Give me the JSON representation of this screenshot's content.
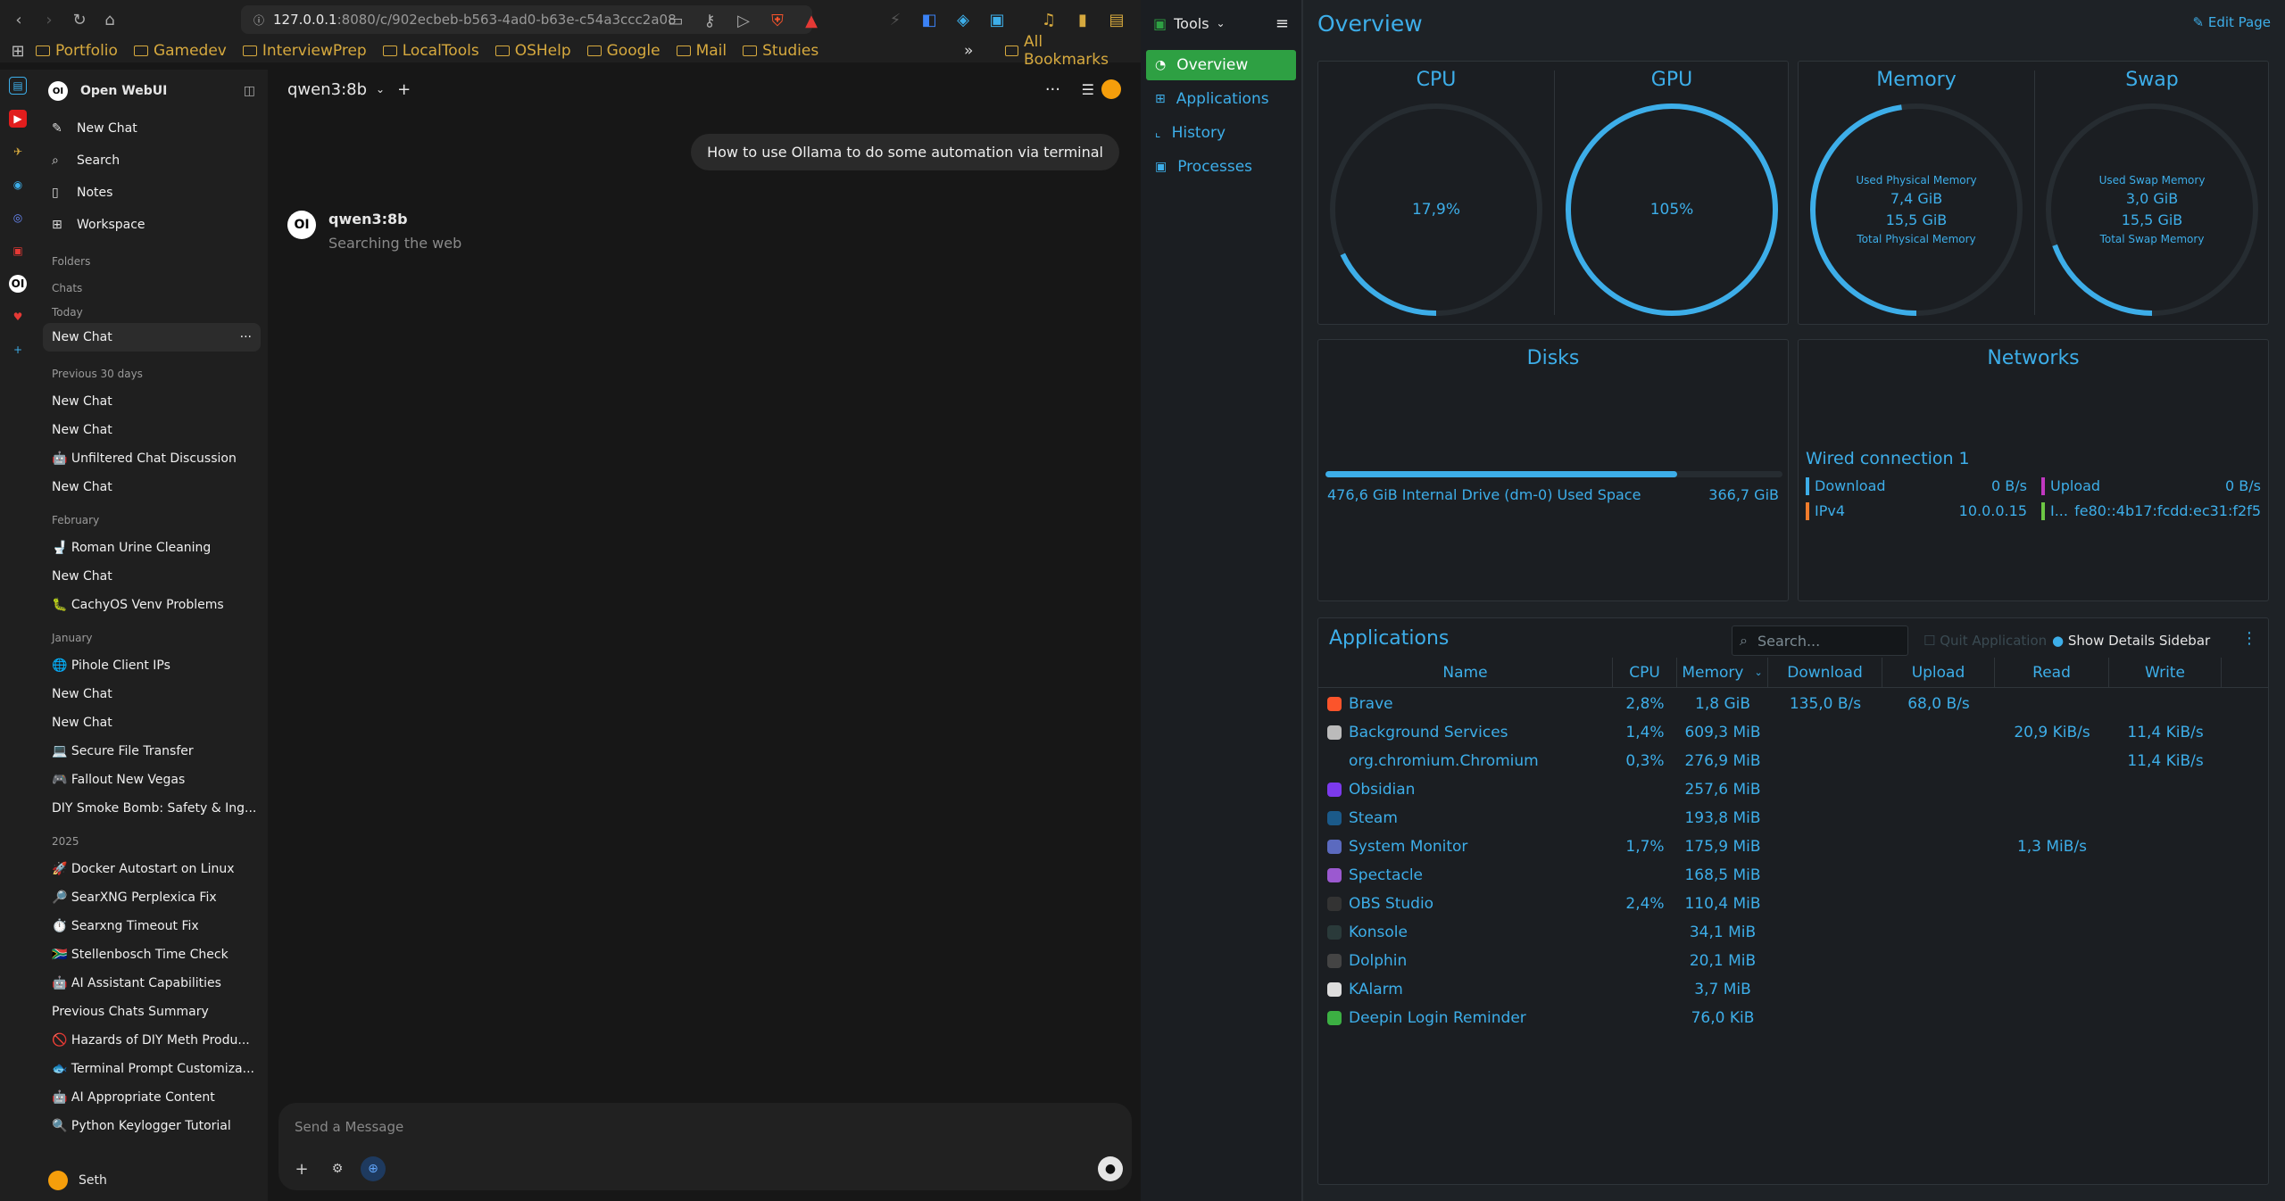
{
  "browser": {
    "url_host": "127.0.0.1",
    "url_path": ":8080/c/902ecbeb-b563-4ad0-b63e-c54a3ccc2a08",
    "bookmarks": [
      "Portfolio",
      "Gamedev",
      "InterviewPrep",
      "LocalTools",
      "OSHelp",
      "Google",
      "Mail",
      "Studies"
    ],
    "overflow": "»",
    "all_bookmarks": "All Bookmarks"
  },
  "owui": {
    "app_name": "Open WebUI",
    "menu": {
      "new_chat": "New Chat",
      "search": "Search",
      "notes": "Notes",
      "workspace": "Workspace"
    },
    "sections": {
      "folders": "Folders",
      "chats": "Chats",
      "today": "Today",
      "prev30": "Previous 30 days",
      "feb": "February",
      "jan": "January",
      "y2025": "2025"
    },
    "today_chats": [
      "New Chat"
    ],
    "prev30_chats": [
      "New Chat",
      "New Chat",
      "🤖 Unfiltered Chat Discussion",
      "New Chat"
    ],
    "feb_chats": [
      "🚽 Roman Urine Cleaning",
      "New Chat",
      "🐛 CachyOS Venv Problems"
    ],
    "jan_chats": [
      "🌐 Pihole Client IPs",
      "New Chat",
      "New Chat",
      "💻 Secure File Transfer",
      "🎮 Fallout New Vegas",
      "DIY Smoke Bomb: Safety & Ing..."
    ],
    "y2025_chats": [
      "🚀 Docker Autostart on Linux",
      "🔎 SearXNG Perplexica Fix",
      "⏱️ Searxng Timeout Fix",
      "🇿🇦 Stellenbosch Time Check",
      "🤖 AI Assistant Capabilities",
      "Previous Chats Summary",
      "🚫 Hazards of DIY Meth Produ...",
      "🐟 Terminal Prompt Customiza...",
      "🤖 AI Appropriate Content",
      "🔍 Python Keylogger Tutorial"
    ],
    "user": "Seth",
    "model": "qwen3:8b",
    "user_message": "How to use Ollama to do some automation via terminal",
    "assistant_name": "qwen3:8b",
    "assistant_status": "Searching the web",
    "composer_placeholder": "Send a Message"
  },
  "sysmon": {
    "tools": "Tools",
    "nav": [
      "Overview",
      "Applications",
      "History",
      "Processes"
    ],
    "title": "Overview",
    "edit_page": "Edit Page",
    "cpu": {
      "title": "CPU",
      "value": "17,9%",
      "fraction": 0.179
    },
    "gpu": {
      "title": "GPU",
      "value": "105%",
      "fraction": 1.0
    },
    "memory": {
      "title": "Memory",
      "used_label": "Used Physical Memory",
      "used": "7,4 GiB",
      "total": "15,5 GiB",
      "total_label": "Total Physical Memory",
      "fraction": 0.477
    },
    "swap": {
      "title": "Swap",
      "used_label": "Used Swap Memory",
      "used": "3,0 GiB",
      "total": "15,5 GiB",
      "total_label": "Total Swap Memory",
      "fraction": 0.194
    },
    "disks": {
      "title": "Disks",
      "label": "476,6 GiB Internal Drive (dm-0) Used Space",
      "value": "366,7 GiB",
      "fraction": 0.77
    },
    "networks": {
      "title": "Networks",
      "conn": "Wired connection 1",
      "download_label": "Download",
      "download": "0 B/s",
      "upload_label": "Upload",
      "upload": "0 B/s",
      "ipv4_label": "IPv4",
      "ipv4": "10.0.0.15",
      "ipv6_label": "I...",
      "ipv6": "fe80::4b17:fcdd:ec31:f2f5"
    },
    "apps": {
      "title": "Applications",
      "search_placeholder": "Search...",
      "quit": "Quit Application",
      "details": "Show Details Sidebar",
      "columns": [
        "Name",
        "CPU",
        "Memory",
        "Download",
        "Upload",
        "Read",
        "Write"
      ],
      "rows": [
        {
          "name": "Brave",
          "cpu": "2,8%",
          "mem": "1,8 GiB",
          "down": "135,0 B/s",
          "up": "68,0 B/s",
          "read": "",
          "write": "",
          "color": "#fb542b"
        },
        {
          "name": "Background Services",
          "cpu": "1,4%",
          "mem": "609,3 MiB",
          "down": "",
          "up": "",
          "read": "20,9 KiB/s",
          "write": "11,4 KiB/s",
          "color": "#bbb"
        },
        {
          "name": "org.chromium.Chromium",
          "cpu": "0,3%",
          "mem": "276,9 MiB",
          "down": "",
          "up": "",
          "read": "",
          "write": "11,4 KiB/s",
          "color": ""
        },
        {
          "name": "Obsidian",
          "cpu": "",
          "mem": "257,6 MiB",
          "down": "",
          "up": "",
          "read": "",
          "write": "",
          "color": "#7c3aed"
        },
        {
          "name": "Steam",
          "cpu": "",
          "mem": "193,8 MiB",
          "down": "",
          "up": "",
          "read": "",
          "write": "",
          "color": "#1b5a8a"
        },
        {
          "name": "System Monitor",
          "cpu": "1,7%",
          "mem": "175,9 MiB",
          "down": "",
          "up": "",
          "read": "1,3 MiB/s",
          "write": "",
          "color": "#5b6abf"
        },
        {
          "name": "Spectacle",
          "cpu": "",
          "mem": "168,5 MiB",
          "down": "",
          "up": "",
          "read": "",
          "write": "",
          "color": "#9b59d0"
        },
        {
          "name": "OBS Studio",
          "cpu": "2,4%",
          "mem": "110,4 MiB",
          "down": "",
          "up": "",
          "read": "",
          "write": "",
          "color": "#333"
        },
        {
          "name": "Konsole",
          "cpu": "",
          "mem": "34,1 MiB",
          "down": "",
          "up": "",
          "read": "",
          "write": "",
          "color": "#2a3a3a"
        },
        {
          "name": "Dolphin",
          "cpu": "",
          "mem": "20,1 MiB",
          "down": "",
          "up": "",
          "read": "",
          "write": "",
          "color": "#444"
        },
        {
          "name": "KAlarm",
          "cpu": "",
          "mem": "3,7 MiB",
          "down": "",
          "up": "",
          "read": "",
          "write": "",
          "color": "#ddd"
        },
        {
          "name": "Deepin Login Reminder",
          "cpu": "",
          "mem": "76,0 KiB",
          "down": "",
          "up": "",
          "read": "",
          "write": "",
          "color": "#3cb043"
        }
      ]
    }
  }
}
